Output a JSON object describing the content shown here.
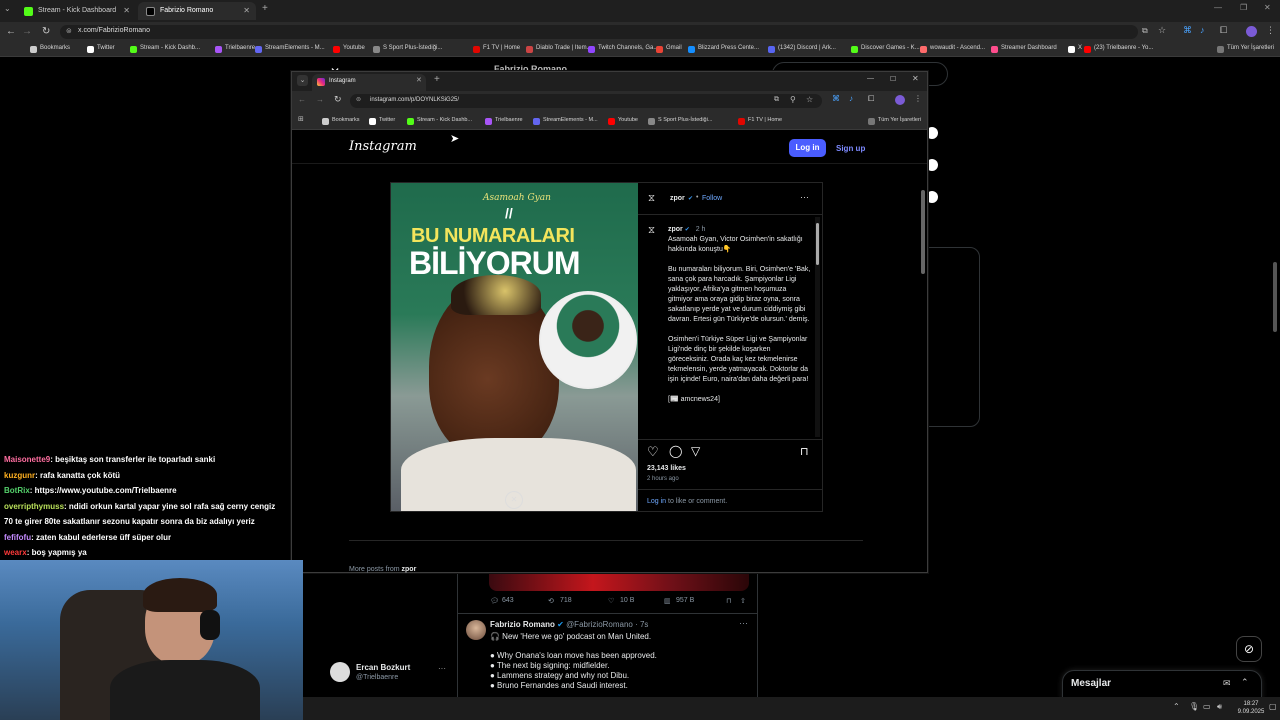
{
  "outer_browser": {
    "tabs": [
      {
        "label": "Stream - Kick Dashboard",
        "active": false
      },
      {
        "label": "Fabrizio Romano (@FabrizioRo…",
        "active": true
      }
    ],
    "url": "x.com/FabrizioRomano",
    "bookmarks": [
      "Bookmarks",
      "Twitter",
      "Stream - Kick Dashb...",
      "Trielbaenre",
      "StreamElements - M...",
      "Youtube",
      "S Sport Plus-İstediği...",
      "F1 TV | Home",
      "Diablo Trade | Item...",
      "Twitch Channels, Ga...",
      "Gmail",
      "Blizzard Press Cente...",
      "(1342) Discord | Ark...",
      "Discover Games - K...",
      "wowaudit - Ascend...",
      "Streamer Dashboard",
      "X",
      "(23) Trielbaenre - Yo..."
    ],
    "all_bookmarks": "Tüm Yer İşaretleri"
  },
  "inner_browser": {
    "tab_label": "Instagram",
    "url": "instagram.com/p/DOYNLKSiG25/",
    "bookmarks": [
      "Bookmarks",
      "Twitter",
      "Stream - Kick Dashb...",
      "Trielbaenre",
      "StreamElements - M...",
      "Youtube",
      "S Sport Plus-İstediği...",
      "F1 TV | Home"
    ],
    "all_bookmarks": "Tüm Yer İşaretleri"
  },
  "instagram": {
    "logo": "Instagram",
    "login": "Log in",
    "signup": "Sign up",
    "post_image": {
      "script_name": "Asamoah Gyan",
      "headline1": "BU NUMARALARI",
      "headline2": "BİLİYORUM"
    },
    "username": "zpor",
    "follow": "Follow",
    "time": "2 h",
    "caption_intro": "Asamoah Gyan, Victor Osimhen'in sakatlığı hakkında konuştu👇",
    "caption_p1": "Bu numaraları biliyorum. Biri, Osimhen'e 'Bak, sana çok para harcadık. Şampiyonlar Ligi yaklaşıyor, Afrika'ya gitmen hoşumuza gitmiyor ama oraya gidip biraz oyna, sonra sakatlanıp yerde yat ve durum ciddiymiş gibi davran. Ertesi gün Türkiye'de olursun.' demiş.",
    "caption_p2": "Osimhen'i Türkiye Süper Ligi ve Şampiyonlar Ligi'nde dinç bir şekilde koşarken göreceksiniz. Orada kaç kez tekmelenirse tekmelensin, yerde yatmayacak. Doktorlar da işin içinde! Euro, naira'dan daha değerli para!",
    "caption_source": "[📰 amcnews24]",
    "likes": "23,143 likes",
    "ago": "2 hours ago",
    "login_prompt_link": "Log in",
    "login_prompt_rest": "to like or comment.",
    "more_posts": "More posts from",
    "more_posts_user": "zpor"
  },
  "twitter": {
    "header_name": "Fabrizio Romano",
    "stats": {
      "replies": "643",
      "retweets": "718",
      "likes": "10 B",
      "views": "957 B"
    },
    "tweet": {
      "name": "Fabrizio Romano",
      "handle": "@FabrizioRomano · 7s",
      "line1": "🎧 New 'Here we go' podcast on Man United.",
      "bullets": [
        "● Why Onana's loan move has been approved.",
        "● The next big signing: midfielder.",
        "● Lammens strategy and why not Dibu.",
        "● Bruno Fernandes and Saudi interest."
      ]
    },
    "account": {
      "name": "Ercan Bozkurt",
      "handle": "@Trielbaenre"
    },
    "messages": "Mesajlar"
  },
  "chat": [
    {
      "user": "Maisonette9",
      "color": "#ff6ea0",
      "text": ": beşiktaş son transferler ile toparladı sanki"
    },
    {
      "user": "kuzgunr",
      "color": "#ffb020",
      "text": ": rafa kanatta çok kötü"
    },
    {
      "user": "BotRix",
      "color": "#54d16b",
      "text": ": https://www.youtube.com/Trielbaenre"
    },
    {
      "user": "overripthymuss",
      "color": "#b9e05a",
      "text": ": ndidi orkun kartal yapar yine sol rafa sağ cerny cengiz"
    },
    {
      "user": "",
      "color": "#ffffff",
      "text": "70 te girer 80te sakatlanır sezonu kapatır sonra da biz adalıyı yeriz"
    },
    {
      "user": "fefifofu",
      "color": "#c58bff",
      "text": ": zaten kabul ederlerse üff süper olur"
    },
    {
      "user": "wearx",
      "color": "#ff3a3a",
      "text": ": boş yapmış ya"
    }
  ],
  "taskbar": {
    "time": "18:27",
    "date": "9.09.2025"
  },
  "colors": {
    "accent_blue": "#4a5dff",
    "ig_link": "#6ea8fe",
    "post_bg_green": "#1f6b4c"
  }
}
